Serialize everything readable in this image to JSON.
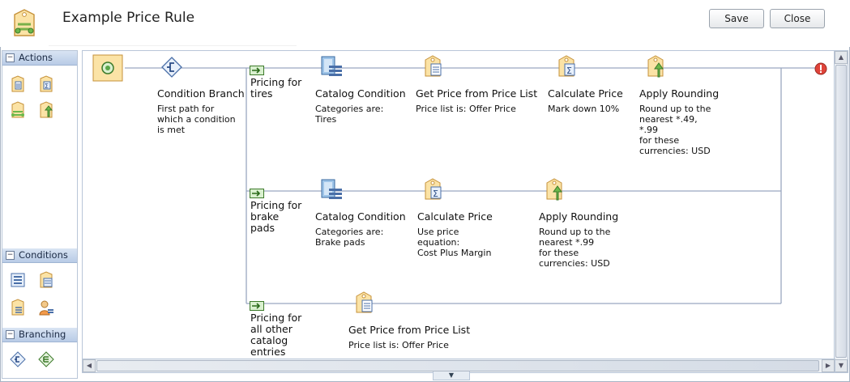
{
  "window": {
    "title": "Example Price Rule"
  },
  "toolbar": {
    "save_label": "Save",
    "close_label": "Close"
  },
  "palette": {
    "actions": {
      "label": "Actions",
      "toggle": "−"
    },
    "conditions": {
      "label": "Conditions",
      "toggle": "−"
    },
    "branching": {
      "label": "Branching",
      "toggle": "−"
    }
  },
  "flow": {
    "condition_branch": {
      "title": "Condition Branch",
      "desc": "First path for\nwhich a condition\nis met"
    },
    "paths": [
      {
        "label": "Pricing for\ntires",
        "nodes": [
          {
            "title": "Catalog Condition",
            "desc": "Categories are:\nTires"
          },
          {
            "title": "Get Price from Price List",
            "desc": "Price list is: Offer Price"
          },
          {
            "title": "Calculate Price",
            "desc": "Mark down 10%"
          },
          {
            "title": "Apply Rounding",
            "desc": "Round up to the\nnearest *.49,\n*.99\nfor these\ncurrencies: USD"
          }
        ]
      },
      {
        "label": "Pricing for\nbrake\npads",
        "nodes": [
          {
            "title": "Catalog Condition",
            "desc": "Categories are:\nBrake pads"
          },
          {
            "title": "Calculate Price",
            "desc": "Use price\nequation:\nCost Plus Margin"
          },
          {
            "title": "Apply Rounding",
            "desc": "Round up to the\nnearest *.99\nfor these\ncurrencies: USD"
          }
        ]
      },
      {
        "label": "Pricing for\nall other\ncatalog\nentries",
        "nodes": [
          {
            "title": "Get Price from Price List",
            "desc": "Price list is: Offer Price"
          }
        ]
      }
    ]
  },
  "colors": {
    "accent": "#f0c060",
    "line": "#9aa8c0",
    "header_grad": "#b8cbe6",
    "end_marker": "#e0443a",
    "start_marker": "#5aa64a"
  }
}
